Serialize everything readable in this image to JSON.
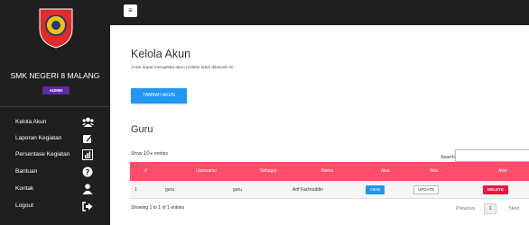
{
  "sidebar": {
    "logo_text_top": "SMK NEGERI 8",
    "logo_text_bottom": "MALANG",
    "brand": "SMK NEGERI 8 MALANG",
    "badge": "ADMIN",
    "items": [
      {
        "label": "Kelola Akun",
        "icon": "users-icon"
      },
      {
        "label": "Laporan Kegiatan",
        "icon": "pencil-square-icon"
      },
      {
        "label": "Persentase Kegiatan",
        "icon": "bar-chart-icon"
      },
      {
        "label": "Bantuan",
        "icon": "question-circle-icon"
      },
      {
        "label": "Kontak",
        "icon": "user-icon"
      },
      {
        "label": "Logout",
        "icon": "sign-out-icon"
      }
    ]
  },
  "topbar": {
    "menu_icon": "hamburger-icon"
  },
  "main": {
    "title": "Kelola Akun",
    "subtitle": "Anda dapat mengelola akun melalui tabel dibawah ini",
    "add_button": "TAMBAH AKUN",
    "section_title": "Guru",
    "show_prefix": "Show",
    "show_value": "10",
    "show_suffix": "entries",
    "search_label": "Search:",
    "search_value": "",
    "table": {
      "headers": [
        "#",
        "Username",
        "Sebagai",
        "Nama",
        "Aksi",
        "Aksi",
        "Aksi"
      ],
      "rows": [
        {
          "no": "1",
          "username": "guru",
          "sebagai": "guru",
          "nama": "Arif Fachruddin",
          "view": "VIEW",
          "update": "UPDATE",
          "delete": "DELETE"
        }
      ]
    },
    "showing": "Showing 1 to 1 of 1 entries",
    "pagination": {
      "previous": "Previous",
      "page": "1",
      "next": "Next"
    }
  },
  "colors": {
    "sidebar_bg": "#1f1f1f",
    "badge": "#5a2aa3",
    "primary": "#2196f3",
    "table_header": "#ff4d6b",
    "delete": "#f4143c",
    "logo_red": "#e02b2b",
    "logo_yellow": "#f2c200"
  }
}
